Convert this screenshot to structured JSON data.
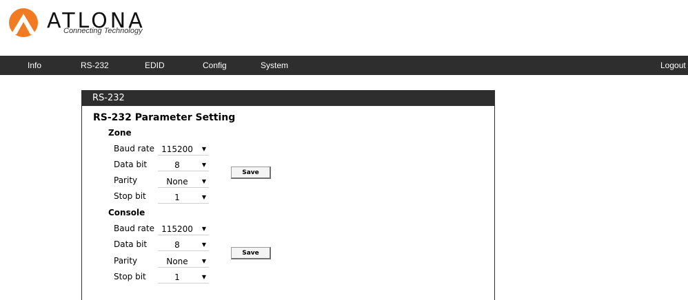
{
  "brand": {
    "name": "ATLONA",
    "tagline": "Connecting Technology",
    "accent_color": "#f07b22",
    "logo_icon": "atlona-logo-icon"
  },
  "nav": {
    "items": [
      {
        "label": "Info"
      },
      {
        "label": "RS-232"
      },
      {
        "label": "EDID"
      },
      {
        "label": "Config"
      },
      {
        "label": "System"
      }
    ],
    "logout_label": "Logout"
  },
  "panel": {
    "title": "RS-232",
    "section_title": "RS-232 Parameter Setting",
    "groups": [
      {
        "label": "Zone",
        "fields": [
          {
            "label": "Baud rate",
            "value": "115200"
          },
          {
            "label": "Data bit",
            "value": "8"
          },
          {
            "label": "Parity",
            "value": "None"
          },
          {
            "label": "Stop bit",
            "value": "1"
          }
        ],
        "save_label": "Save"
      },
      {
        "label": "Console",
        "fields": [
          {
            "label": "Baud rate",
            "value": "115200"
          },
          {
            "label": "Data bit",
            "value": "8"
          },
          {
            "label": "Parity",
            "value": "None"
          },
          {
            "label": "Stop bit",
            "value": "1"
          }
        ],
        "save_label": "Save"
      }
    ]
  },
  "colors": {
    "navbar_bg": "#2e2e2e",
    "nav_text": "#ffffff"
  }
}
